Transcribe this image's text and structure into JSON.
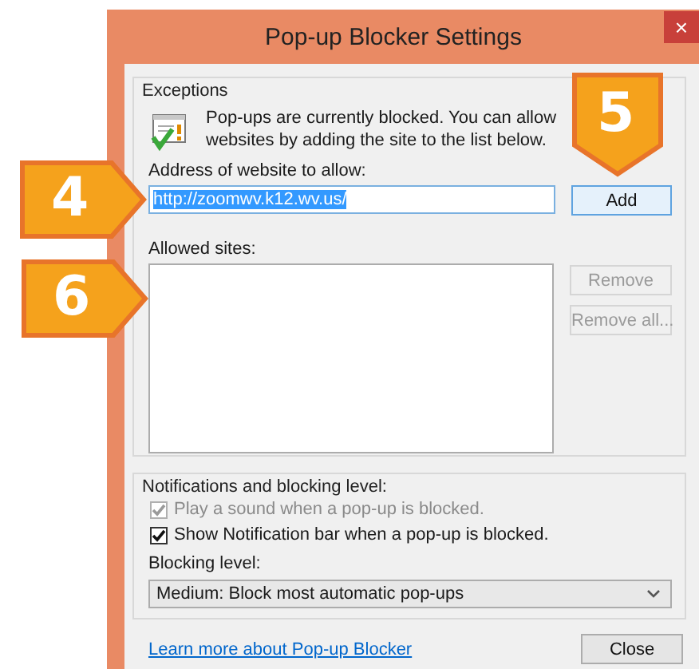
{
  "window": {
    "title": "Pop-up Blocker Settings",
    "close": "×"
  },
  "exceptions": {
    "legend": "Exceptions",
    "message": "Pop-ups are currently blocked. You can allow",
    "message_2": "websites by adding the site to the list below.",
    "address_label": "Address of website to allow:",
    "address_value": "http://zoomwv.k12.wv.us/",
    "address_selected": true,
    "add_button": {
      "label": "Add",
      "disabled": false
    },
    "allowed_label": "Allowed sites:",
    "side_buttons": [
      {
        "label": "Remove",
        "disabled": true
      },
      {
        "label": "Remove all...",
        "disabled": true
      }
    ]
  },
  "notifications": {
    "legend": "Notifications and blocking level:",
    "options": [
      {
        "label": "Play a sound when a pop-up is blocked.",
        "checked": true,
        "disabled": true
      },
      {
        "label": "Show Notification bar when a pop-up is blocked.",
        "checked": true,
        "disabled": false
      }
    ],
    "blocking_label": "Blocking level:",
    "blocking_value": "Medium: Block most automatic pop-ups"
  },
  "footer": {
    "link": "Learn more about Pop-up Blocker",
    "close_button": "Close"
  },
  "callouts": [
    {
      "number": "4",
      "kind": "right"
    },
    {
      "number": "5",
      "kind": "down"
    },
    {
      "number": "6",
      "kind": "right"
    }
  ]
}
